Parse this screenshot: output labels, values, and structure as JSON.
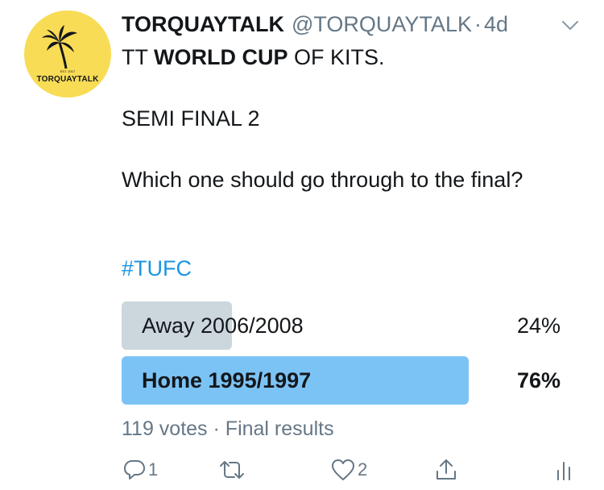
{
  "tweet": {
    "display_name": "TORQUAYTALK",
    "handle": "@TORQUAYTALK",
    "separator": "·",
    "time": "4d",
    "text_line1_prefix": "TT ",
    "text_line1_bold": "WORLD CUP",
    "text_line1_suffix": " OF KITS.",
    "text_line2": "SEMI FINAL 2",
    "text_line3": "Which one should go through to the final?",
    "hashtag": "#TUFC"
  },
  "avatar": {
    "est": "EST. 2017",
    "brand": "TORQUAYTALK",
    "color": "#f8dc55"
  },
  "poll": {
    "options": [
      {
        "label": "Away 2006/2008",
        "percent_text": "24%",
        "fraction": 0.24
      },
      {
        "label": "Home 1995/1997",
        "percent_text": "76%",
        "fraction": 0.76
      }
    ],
    "votes": "119 votes",
    "separator": "·",
    "status": "Final results",
    "colors": {
      "loser": "#ccd6dd",
      "winner": "#7cc3f5"
    }
  },
  "actions": {
    "reply_count": "1",
    "retweet_count": "",
    "like_count": "2",
    "icons": [
      "reply-icon",
      "retweet-icon",
      "like-icon",
      "share-icon",
      "analytics-icon"
    ]
  },
  "colors": {
    "link": "#1b95e0",
    "muted": "#657786",
    "text": "#14171a"
  }
}
